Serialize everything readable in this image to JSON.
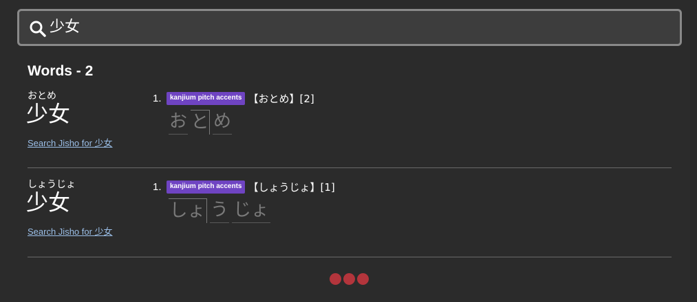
{
  "search": {
    "query": "少女"
  },
  "results": {
    "title": "Words - 2",
    "entries": [
      {
        "furigana": "おとめ",
        "word": "少女",
        "jisho_link": "Search Jisho for 少女",
        "sense_number": "1.",
        "tag": "kanjium pitch accents",
        "definition": "【おとめ】[2]",
        "pitch_morae": [
          "お",
          "と",
          "め"
        ]
      },
      {
        "furigana": "しょうじょ",
        "word": "少女",
        "jisho_link": "Search Jisho for 少女",
        "sense_number": "1.",
        "tag": "kanjium pitch accents",
        "definition": "【しょうじょ】[1]",
        "pitch_morae": [
          "しょ",
          "う",
          "じょ"
        ]
      }
    ]
  },
  "colors": {
    "background": "#2b2b2b",
    "tag": "#6f44c2",
    "link": "#9bbfe8",
    "loader": "#b3353c"
  }
}
